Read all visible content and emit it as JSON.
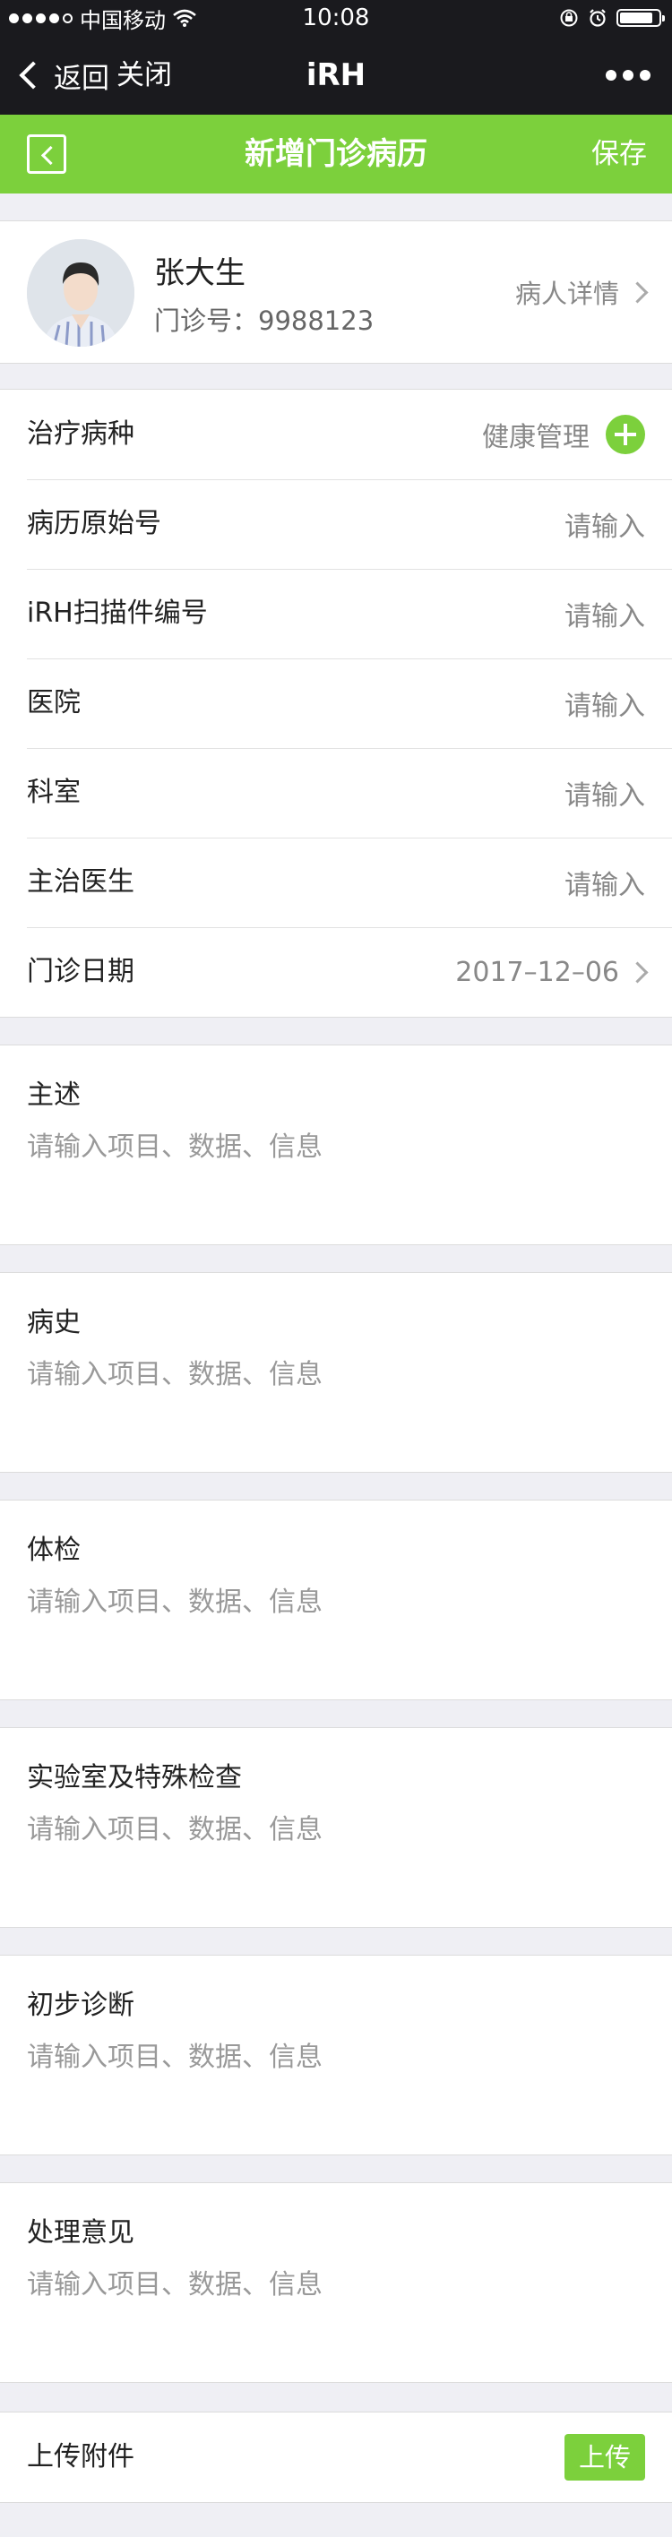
{
  "status_bar": {
    "carrier": "中国移动",
    "time": "10:08",
    "battery_level": 0.85
  },
  "navbar": {
    "back_label": "返回",
    "close_label": "关闭",
    "title": "iRH"
  },
  "header": {
    "title": "新增门诊病历",
    "save_label": "保存"
  },
  "patient": {
    "name": "张大生",
    "clinic_no": "门诊号：9988123",
    "detail_label": "病人详情"
  },
  "form": {
    "rows": [
      {
        "label": "治疗病种",
        "value": "健康管理"
      },
      {
        "label": "病历原始号",
        "value": "请输入"
      },
      {
        "label": "iRH扫描件编号",
        "value": "请输入"
      },
      {
        "label": "医院",
        "value": "请输入"
      },
      {
        "label": "科室",
        "value": "请输入"
      },
      {
        "label": "主治医生",
        "value": "请输入"
      },
      {
        "label": "门诊日期",
        "value": "2017–12–06"
      }
    ]
  },
  "sections": [
    {
      "title": "主述",
      "placeholder": "请输入项目、数据、信息"
    },
    {
      "title": "病史",
      "placeholder": "请输入项目、数据、信息"
    },
    {
      "title": "体检",
      "placeholder": "请输入项目、数据、信息"
    },
    {
      "title": "实验室及特殊检查",
      "placeholder": "请输入项目、数据、信息"
    },
    {
      "title": "初步诊断",
      "placeholder": "请输入项目、数据、信息"
    },
    {
      "title": "处理意见",
      "placeholder": "请输入项目、数据、信息"
    }
  ],
  "attachment": {
    "label": "上传附件",
    "upload_label": "上传"
  },
  "colors": {
    "accent": "#7cd03c",
    "dark_bar": "#1a1a1e",
    "background": "#efeff4"
  },
  "icons": {
    "signal": "signal-dots-icon",
    "wifi": "wifi-icon",
    "lock": "orientation-lock-icon",
    "alarm": "alarm-icon",
    "battery": "battery-icon",
    "back": "chevron-left-icon",
    "more": "more-dots-icon",
    "add": "plus-circle-icon",
    "arrow": "chevron-right-icon"
  }
}
